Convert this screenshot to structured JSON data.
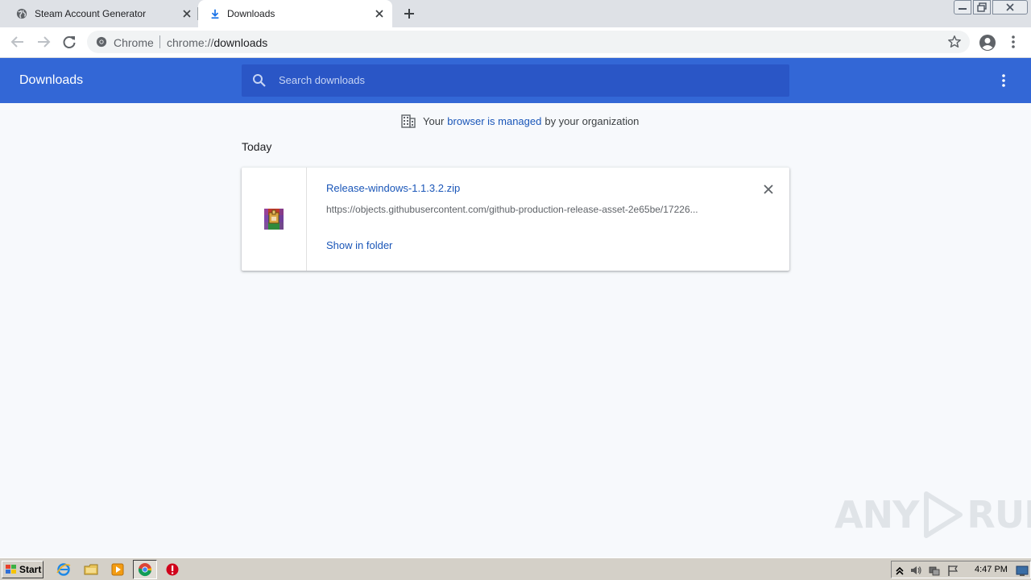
{
  "tabs": [
    {
      "title": "Steam Account Generator",
      "icon": "globe-icon",
      "active": false
    },
    {
      "title": "Downloads",
      "icon": "download-icon",
      "active": true
    }
  ],
  "omnibox": {
    "label": "Chrome",
    "url_scheme": "chrome://",
    "url_host": "downloads"
  },
  "header": {
    "title": "Downloads",
    "search_placeholder": "Search downloads"
  },
  "managed_notice": {
    "before": "Your",
    "link": "browser is managed",
    "after": "by your organization"
  },
  "date_heading": "Today",
  "download": {
    "file_name": "Release-windows-1.1.3.2.zip",
    "url": "https://objects.githubusercontent.com/github-production-release-asset-2e65be/17226...",
    "action": "Show in folder",
    "icon": "winrar-archive-icon"
  },
  "watermark": {
    "left": "ANY",
    "right": "RUN"
  },
  "taskbar": {
    "start_label": "Start",
    "clock": "4:47 PM"
  },
  "colors": {
    "header_blue": "#3367d6",
    "link_blue": "#1a56b8",
    "page_bg": "#f7f9fc",
    "tab_strip": "#dee1e6"
  }
}
